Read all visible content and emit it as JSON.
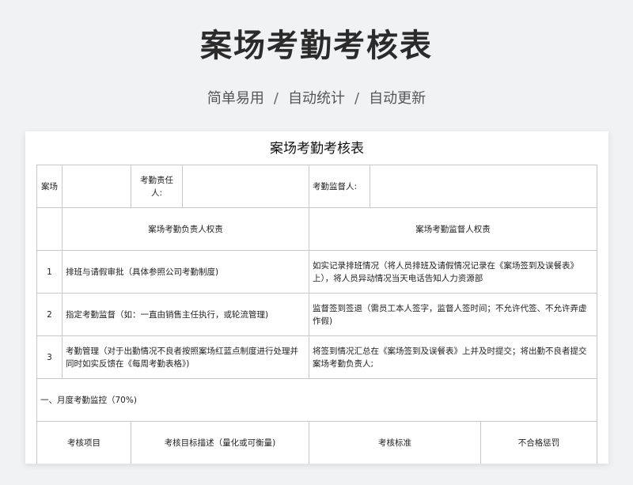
{
  "header": {
    "title": "案场考勤考核表",
    "subtitle": [
      "简单易用",
      "自动统计",
      "自动更新"
    ],
    "separator": "/"
  },
  "sheet": {
    "title": "案场考勤考核表",
    "info_row": {
      "site_label": "案场",
      "site_value": "",
      "responsible_label": "考勤责任人:",
      "responsible_value": "",
      "supervisor_label": "考勤监督人:",
      "supervisor_value": ""
    },
    "duties_header": {
      "left": "案场考勤负责人权责",
      "right": "案场考勤监督人权责"
    },
    "duties": [
      {
        "no": "1",
        "responsible": "排班与请假审批（具体参照公司考勤制度)",
        "supervisor": "如实记录排班情况（将人员排班及请假情况记录在《案场签到及误餐表》上），将人员异动情况当天电话告知人力资源部"
      },
      {
        "no": "2",
        "responsible": "指定考勤监督（如：一直由销售主任执行，或轮流管理)",
        "supervisor": "监督签到签退（需员工本人签字，监督人签时间；不允许代签、不允许弄虚作假)"
      },
      {
        "no": "3",
        "responsible": "考勤管理（对于出勤情况不良者按照案场红蓝点制度进行处理并同时如实反馈在《每周考勤表格》)",
        "supervisor": "将签到情况汇总在《案场签到及误餐表》上并及时提交；将出勤不良者提交案场考勤负责人;"
      }
    ],
    "section": "一、月度考勤监控（70%)",
    "criteria_header": [
      "考核项目",
      "考核目标描述（量化或可衡量)",
      "考核标准",
      "不合格惩罚"
    ]
  }
}
